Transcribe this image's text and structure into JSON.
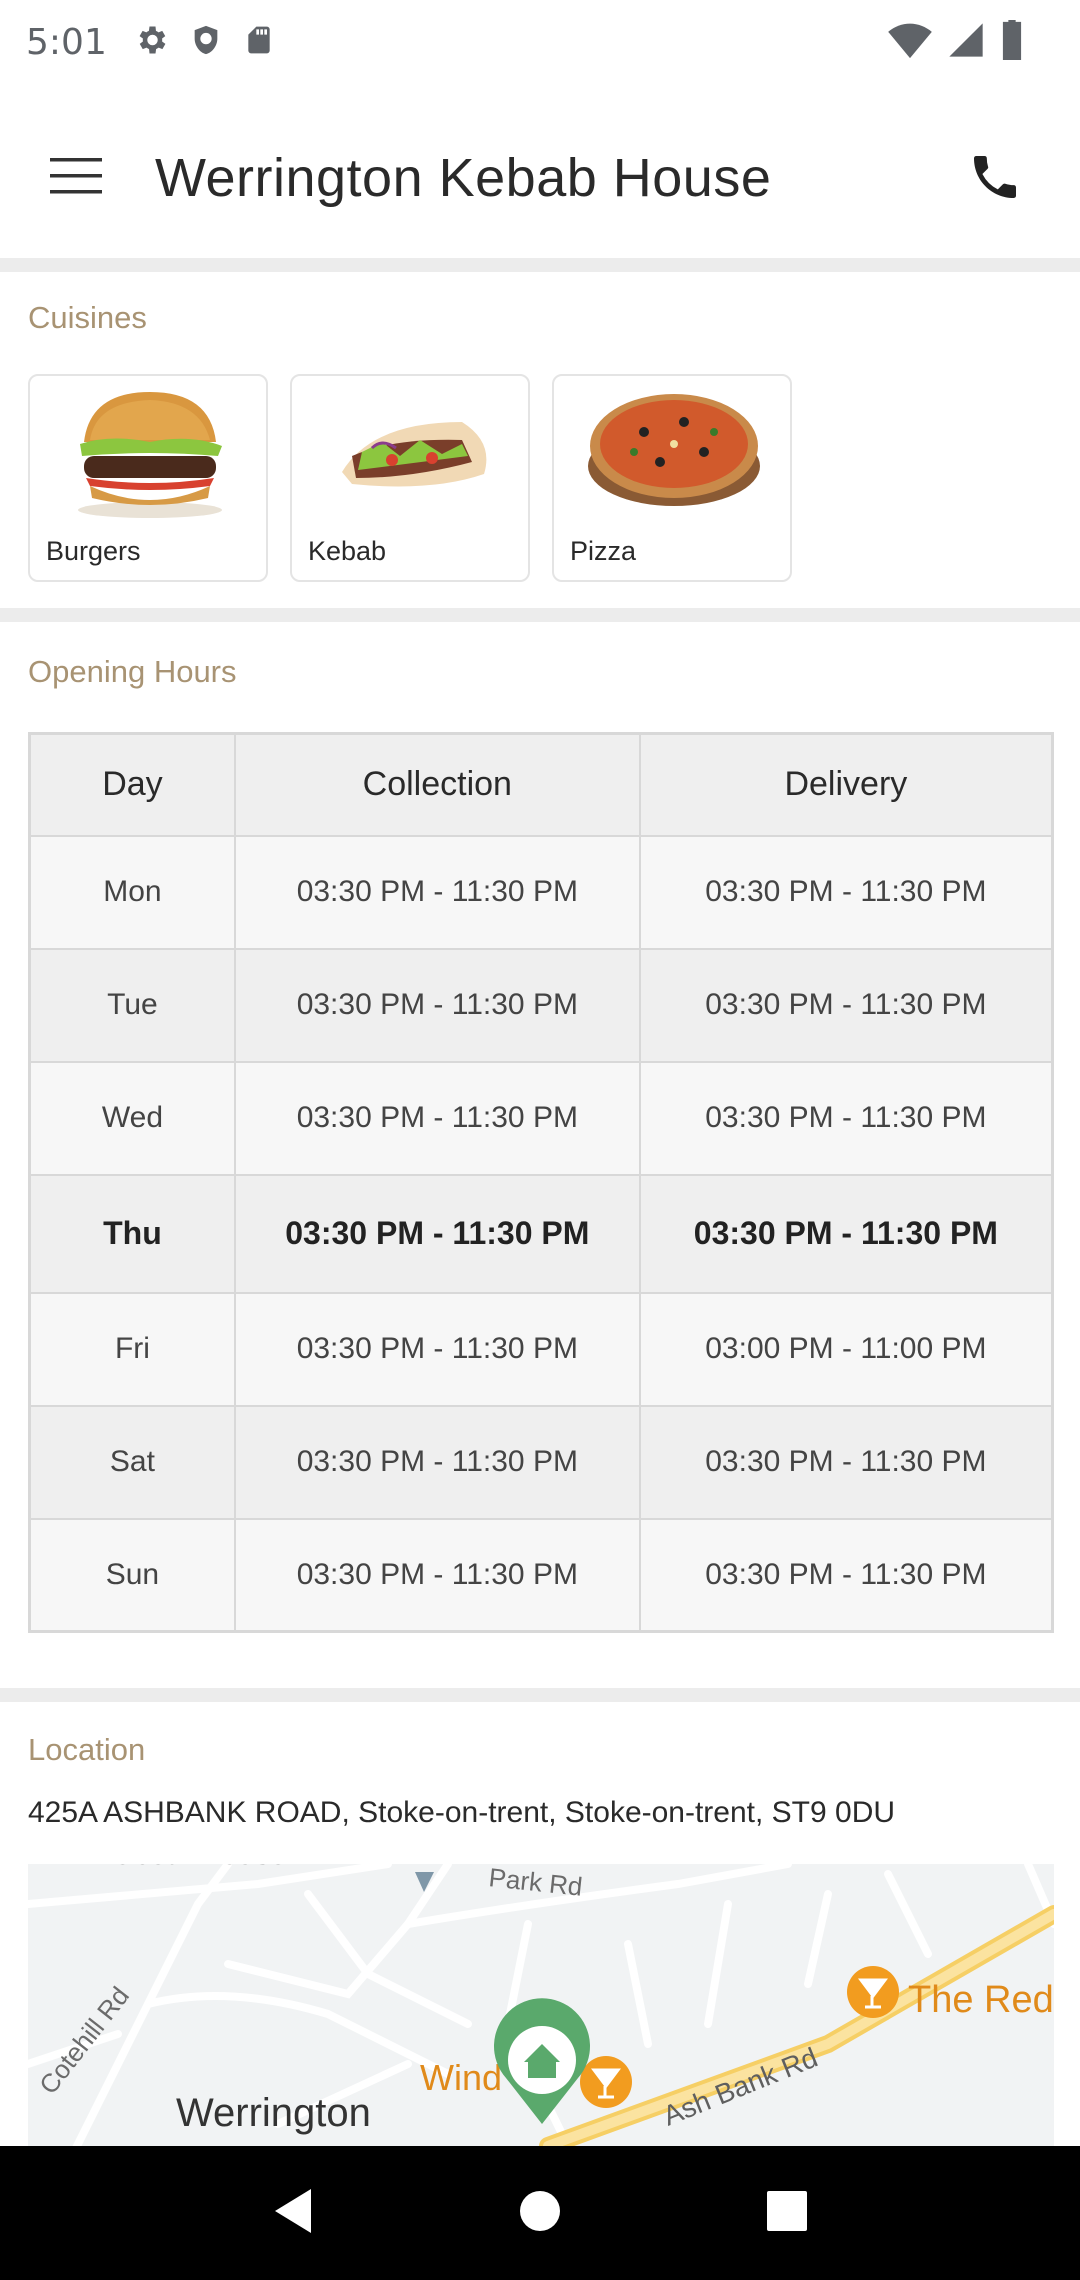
{
  "status_bar": {
    "time": "5:01",
    "icons_left": [
      "gear-icon",
      "shield-icon",
      "sd-card-icon"
    ],
    "icons_right": [
      "wifi-icon",
      "cell-signal-icon",
      "battery-icon"
    ]
  },
  "app_bar": {
    "title": "Werrington Kebab House",
    "menu_icon": "hamburger-menu-icon",
    "call_icon": "phone-icon"
  },
  "cuisines": {
    "title": "Cuisines",
    "items": [
      {
        "label": "Burgers",
        "icon": "burger-image"
      },
      {
        "label": "Kebab",
        "icon": "kebab-image"
      },
      {
        "label": "Pizza",
        "icon": "pizza-image"
      }
    ]
  },
  "opening_hours": {
    "title": "Opening Hours",
    "headers": {
      "day": "Day",
      "collection": "Collection",
      "delivery": "Delivery"
    },
    "rows": [
      {
        "day": "Mon",
        "collection": "03:30 PM - 11:30 PM",
        "delivery": "03:30 PM - 11:30 PM"
      },
      {
        "day": "Tue",
        "collection": "03:30 PM - 11:30 PM",
        "delivery": "03:30 PM - 11:30 PM"
      },
      {
        "day": "Wed",
        "collection": "03:30 PM - 11:30 PM",
        "delivery": "03:30 PM - 11:30 PM"
      },
      {
        "day": "Thu",
        "collection": "03:30 PM - 11:30 PM",
        "delivery": "03:30 PM - 11:30 PM",
        "today": true
      },
      {
        "day": "Fri",
        "collection": "03:30 PM - 11:30 PM",
        "delivery": "03:00 PM - 11:00 PM"
      },
      {
        "day": "Sat",
        "collection": "03:30 PM - 11:30 PM",
        "delivery": "03:30 PM - 11:30 PM"
      },
      {
        "day": "Sun",
        "collection": "03:30 PM - 11:30 PM",
        "delivery": "03:30 PM - 11:30 PM"
      }
    ]
  },
  "location": {
    "title": "Location",
    "address": "425A ASHBANK ROAD, Stoke-on-trent, Stoke-on-trent, ST9 0DU",
    "map_labels": {
      "elizabeth_house": "Elizabeth House",
      "park_rd": "Park Rd",
      "cotehill_rd": "Cotehill Rd",
      "werrington": "Werrington",
      "windmill": "Wind",
      "ash_bank_rd": "Ash Bank Rd",
      "the_red": "The Red"
    }
  },
  "nav_bar": {
    "back": "back-icon",
    "home": "home-icon",
    "recents": "recents-icon"
  },
  "colors": {
    "section_title": "#a89373",
    "divider": "#ececec",
    "map_road_major": "#f6cf65",
    "map_marker_green": "#5aa96c",
    "map_poi_orange": "#f29c1f"
  }
}
